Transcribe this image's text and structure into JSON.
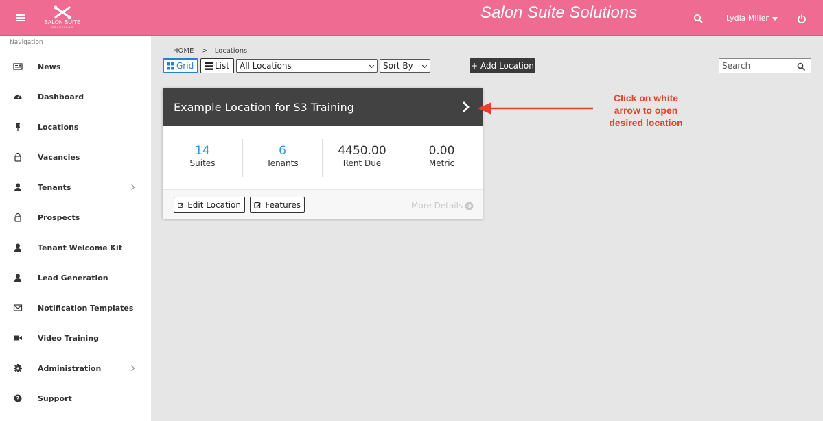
{
  "header": {
    "logo_text": "SALON SUITE",
    "logo_subtext": "SOLUTIONS",
    "brand_title": "Salon Suite Solutions",
    "user_name": "Lydia Miller"
  },
  "sidebar": {
    "nav_label": "Navigation",
    "items": [
      {
        "label": "News",
        "icon": "newspaper-icon"
      },
      {
        "label": "Dashboard",
        "icon": "dashboard-gauge-icon"
      },
      {
        "label": "Locations",
        "icon": "pin-icon"
      },
      {
        "label": "Vacancies",
        "icon": "lock-icon"
      },
      {
        "label": "Tenants",
        "icon": "user-icon",
        "has_submenu": true
      },
      {
        "label": "Prospects",
        "icon": "lock-icon"
      },
      {
        "label": "Tenant Welcome Kit",
        "icon": "user-icon"
      },
      {
        "label": "Lead Generation",
        "icon": "user-icon"
      },
      {
        "label": "Notification Templates",
        "icon": "envelope-icon"
      },
      {
        "label": "Video Training",
        "icon": "video-camera-icon"
      },
      {
        "label": "Administration",
        "icon": "gear-icon",
        "has_submenu": true
      },
      {
        "label": "Support",
        "icon": "question-circle-icon"
      }
    ]
  },
  "breadcrumb": {
    "home": "HOME",
    "separator": ">",
    "current": "Locations"
  },
  "toolbar": {
    "grid_label": "Grid",
    "list_label": "List",
    "location_filter": "All Locations",
    "sort_label": "Sort By",
    "add_location_label": "+ Add Location",
    "search_placeholder": "Search"
  },
  "location_card": {
    "title": "Example Location for S3 Training",
    "stats": [
      {
        "value": "14",
        "label": "Suites"
      },
      {
        "value": "6",
        "label": "Tenants"
      },
      {
        "value": "4450.00",
        "label": "Rent Due"
      },
      {
        "value": "0.00",
        "label": "Metric"
      }
    ],
    "edit_label": "Edit Location",
    "features_label": "Features",
    "more_details_label": "More Details"
  },
  "annotation": {
    "lines": [
      "Click on white",
      "arrow to open",
      "desired location"
    ],
    "color": "#e8402c"
  },
  "colors": {
    "header_bg": "#ef6b91",
    "card_header_bg": "#424242",
    "accent_blue": "#2a9fd8"
  }
}
